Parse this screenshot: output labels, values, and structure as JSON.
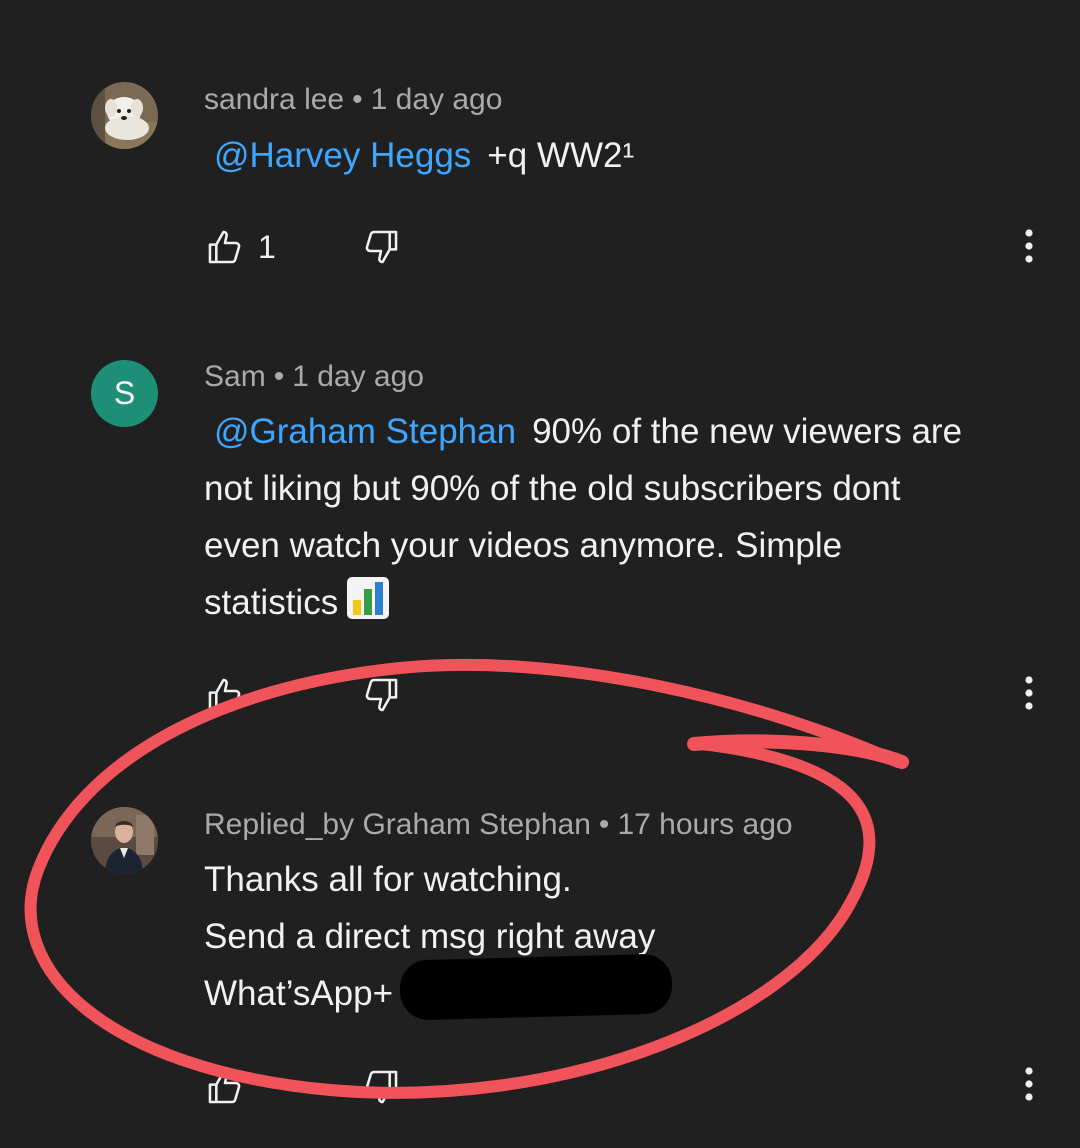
{
  "comments": [
    {
      "author": "sandra lee",
      "time": "1 day ago",
      "mention": "@Harvey Heggs",
      "text": "+q WW2¹",
      "likes": "1",
      "avatar_icon": "dog-photo-avatar"
    },
    {
      "author": "Sam",
      "avatar_letter": "S",
      "time": "1 day ago",
      "mention": "@Graham Stephan",
      "lines": [
        "90% of the new viewers are",
        "not liking but 90% of the old subscribers dont",
        "even watch your videos anymore. Simple",
        "statistics"
      ],
      "emoji_icon": "bar-chart-emoji",
      "avatar_color": "#1e8f77"
    },
    {
      "author": "Replied_by Graham Stephan",
      "time": "17 hours ago",
      "lines": [
        "Thanks all for watching.",
        "Send a direct msg right away",
        "What’sApp+"
      ],
      "avatar_icon": "man-in-suit-photo-avatar",
      "redacted": true
    }
  ],
  "separator": "•",
  "colors": {
    "background": "#202020",
    "text": "#f1f1f1",
    "meta": "#aaaaaa",
    "mention": "#3ea6ff",
    "annotation": "#f0545a",
    "redaction": "#000000"
  }
}
